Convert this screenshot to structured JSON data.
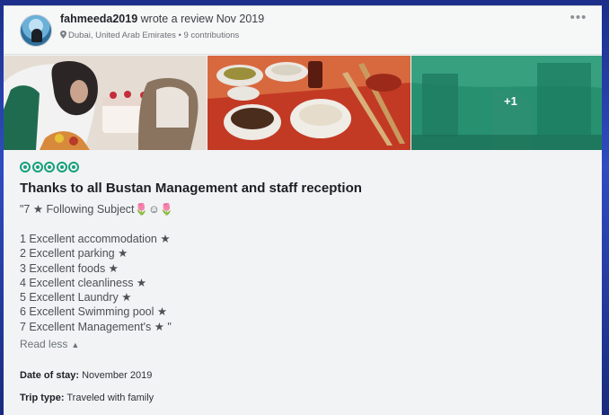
{
  "reviewer": {
    "name": "fahmeeda2019",
    "action": " wrote a review Nov 2019",
    "location": "Dubai, United Arab Emirates",
    "contributions": " • 9 contributions",
    "more_icon": "•••"
  },
  "photos": {
    "extra_count": "+1"
  },
  "review": {
    "rating": 5,
    "rating_color": "#17a07b",
    "title": "Thanks to all Bustan Management and staff reception",
    "subject": "\"7 ★ Following Subject🌷☺🌷",
    "items": [
      "1 Excellent accommodation ★",
      "2 Excellent parking ★",
      "3 Excellent foods  ★",
      "4 Excellent cleanliness ★",
      "5 Excellent Laundry ★",
      "6 Excellent Swimming pool ★",
      "7 Excellent Management's ★ \""
    ],
    "read_less": "Read less",
    "date_label": "Date of stay:",
    "date_value": " November 2019",
    "trip_label": "Trip type:",
    "trip_value": " Traveled with family"
  }
}
